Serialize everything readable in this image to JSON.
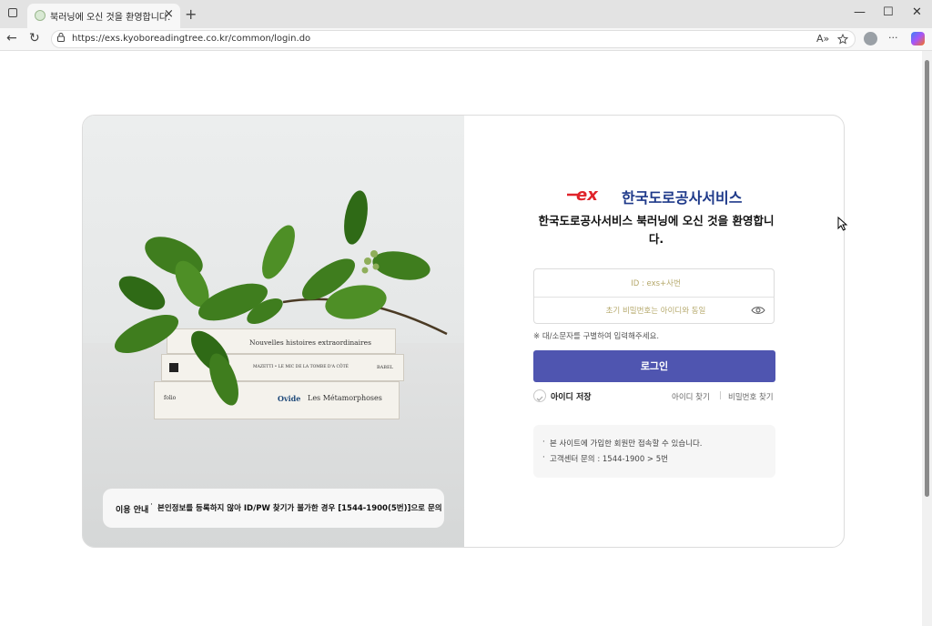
{
  "browser": {
    "tab_title": "북러닝에 오신 것을 환영합니다.",
    "tab_close": "×",
    "new_tab": "+",
    "url": "https://exs.kyoboreadingtree.co.kr/common/login.do",
    "read_aloud": "A»",
    "window": {
      "minimize": "—",
      "maximize": "☐",
      "close": "✕"
    },
    "nav": {
      "back": "←",
      "refresh": "↻"
    },
    "more": "···"
  },
  "left_panel": {
    "books": [
      {
        "title": "Nouvelles histoires extraordinaires"
      },
      {
        "title": "MAZETTI • LE MIC DE LA TOMBE D'A CÔTÉ",
        "publisher": "BABEL"
      },
      {
        "publisher": "folio",
        "author": "Ovide",
        "title": "Les Métamorphoses"
      }
    ],
    "notice_label": "이용 안내",
    "notice_text": "본인정보를 등록하지 않아 ID/PW 찾기가 불가한 경우 [1544-1900(5번)]으로 문의"
  },
  "login": {
    "logo_text": "ex",
    "brand_name": "한국도로공사서비스",
    "welcome": "한국도로공사서비스 북러닝에 오신 것을 환영합니다.",
    "id_placeholder": "ID : exs+사번",
    "pw_placeholder": "초기 비밀번호는 아이디와 동일",
    "case_note": "※ 대/소문자를 구별하여 입력해주세요.",
    "login_button": "로그인",
    "save_id": "아이디 저장",
    "find_id": "아이디 찾기",
    "find_pw": "비밀번호 찾기",
    "info": [
      "본 사이트에 가입한 회원만 접속할 수 있습니다.",
      "고객센터 문의 : 1544-1900 > 5번"
    ]
  },
  "colors": {
    "accent": "#4f55b0",
    "brand": "#1f3a8a",
    "logo_red": "#e0242b"
  }
}
